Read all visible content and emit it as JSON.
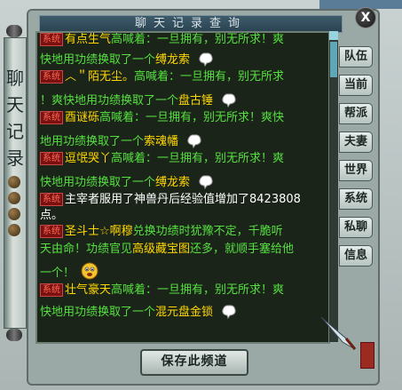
{
  "window": {
    "title": "聊天记录查询",
    "close_label": "X",
    "side_title": [
      "聊",
      "天",
      "记",
      "录"
    ]
  },
  "tabs": [
    {
      "label": "队伍"
    },
    {
      "label": "当前"
    },
    {
      "label": "帮派"
    },
    {
      "label": "夫妻"
    },
    {
      "label": "世界"
    },
    {
      "label": "系统"
    },
    {
      "label": "私聊"
    },
    {
      "label": "信息"
    }
  ],
  "system_tag": "系统",
  "messages": [
    {
      "row1": "有点生气",
      "row1_rest": "高喊着：一旦拥有，别无所求！爽",
      "row2": "快地用功绩换取了一个",
      "row2_item": "缚龙索"
    },
    {
      "row1": "︿＂陌无尘。",
      "row1_rest": "高喊着：一旦拥有，别无所求",
      "row2": "！爽快地用功绩换取了一个",
      "row2_item": "盘古锤"
    },
    {
      "row1": "酉谜砾",
      "row1_rest": "高喊着：一旦拥有，别无所求！爽快",
      "row2": "地用功绩换取了一个",
      "row2_item": "索魂幡"
    },
    {
      "row1": "逗氓哭丫",
      "row1_rest": "高喊着：一旦拥有，别无所求！爽",
      "row2": "快地用功绩换取了一个",
      "row2_item": "缚龙索"
    },
    {
      "row1": "主宰者服用了神兽丹后经验值增加了8423808",
      "row2": "点。"
    },
    {
      "row1": "圣斗士☆啊穆",
      "row1_rest": "兑换功绩时犹豫不定，千脆听",
      "row2": "天由命！功绩官见",
      "row2_b": "高级藏宝图",
      "row2_c": "还多，就顺手塞给他",
      "row3": "一个！"
    },
    {
      "row1": "壮气豪天",
      "row1_rest": "高喊着：一旦拥有，别无所求！爽",
      "row2": "快地用功绩换取了一个",
      "row2_item": "混元盘金锁"
    }
  ],
  "save_button_label": "保存此频道",
  "seal_text": "印"
}
